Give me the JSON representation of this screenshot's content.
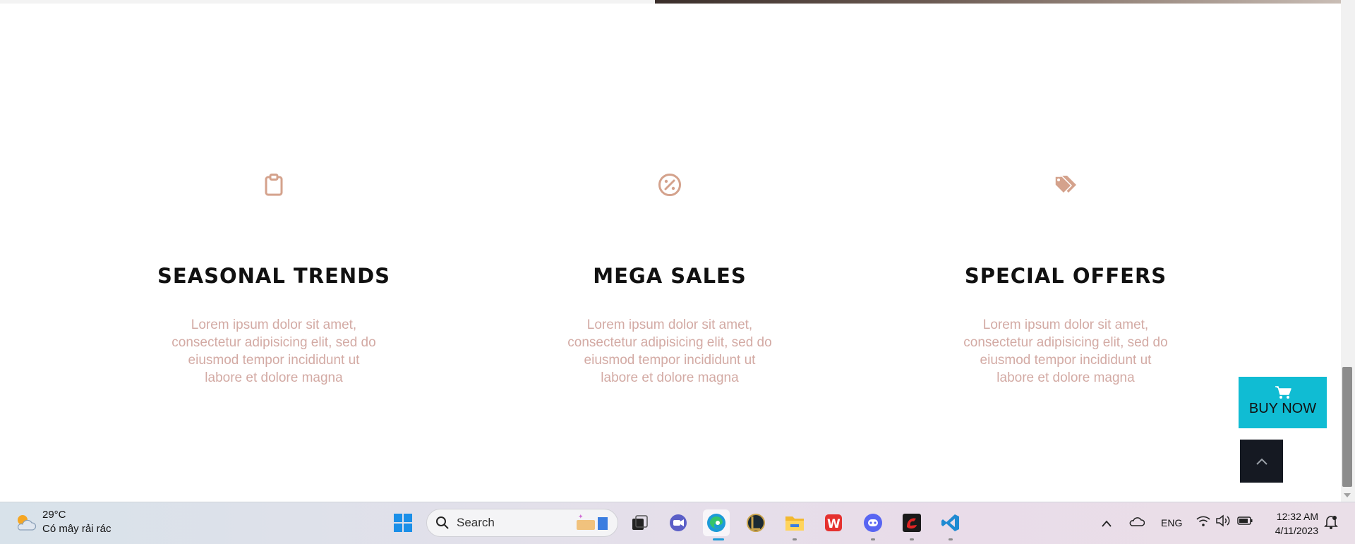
{
  "features": [
    {
      "icon": "clipboard-icon",
      "title": "SEASONAL TRENDS",
      "text": "Lorem ipsum dolor sit amet, consectetur adipisicing elit, sed do eiusmod tempor incididunt ut labore et dolore magna"
    },
    {
      "icon": "percent-badge-icon",
      "title": "MEGA SALES",
      "text": "Lorem ipsum dolor sit amet, consectetur adipisicing elit, sed do eiusmod tempor incididunt ut labore et dolore magna"
    },
    {
      "icon": "tags-icon",
      "title": "SPECIAL OFFERS",
      "text": "Lorem ipsum dolor sit amet, consectetur adipisicing elit, sed do eiusmod tempor incididunt ut labore et dolore magna"
    }
  ],
  "buy_now": {
    "label": "BUY NOW",
    "icon": "cart-icon"
  },
  "back_to_top": {
    "icon": "chevron-up-icon"
  },
  "colors": {
    "accent": "#d4a28c",
    "text_muted": "#d3aaa4",
    "buy_now_bg": "#10bcd3",
    "back_top_bg": "#151922"
  },
  "taskbar": {
    "weather": {
      "temp": "29°C",
      "desc": "Có mây rải rác"
    },
    "search": {
      "placeholder": "Search"
    },
    "apps": [
      "start-icon",
      "task-view-icon",
      "meet-icon",
      "edge-icon",
      "league-icon",
      "file-explorer-icon",
      "wps-icon",
      "discord-icon",
      "garena-icon",
      "vscode-icon"
    ],
    "tray": {
      "lang": "ENG"
    },
    "clock": {
      "time": "12:32 AM",
      "date": "4/11/2023"
    }
  }
}
